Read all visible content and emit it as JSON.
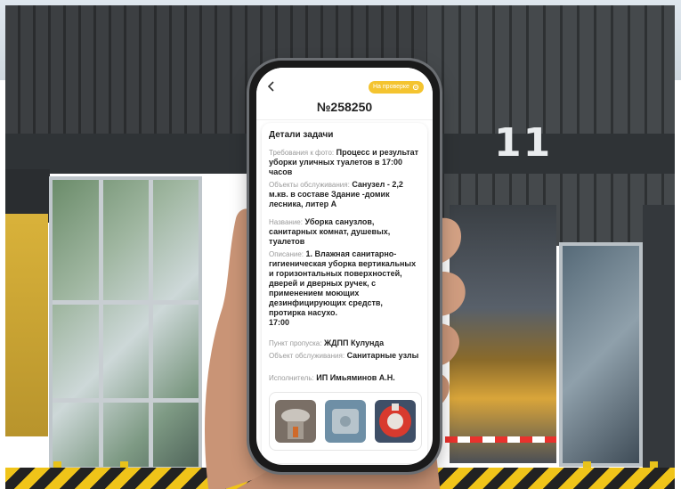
{
  "building": {
    "unit_number": "11"
  },
  "header": {
    "back_icon": "chevron-left-icon",
    "status_label": "На проверке",
    "status_icon": "gear-icon",
    "task_number": "№258250",
    "accent_color": "#f4c430"
  },
  "details": {
    "title": "Детали задачи",
    "photo_requirements": {
      "label": "Требования к фото:",
      "value": "Процесс и результат уборки уличных туалетов  в 17:00 часов"
    },
    "service_objects": {
      "label": "Объекты обслуживания:",
      "value": "Санузел - 2,2 м.кв. в составе Здание -домик лесника, литер А"
    },
    "name": {
      "label": "Название:",
      "value": "Уборка санузлов, санитарных комнат, душевых, туалетов"
    },
    "description": {
      "label": "Описание:",
      "value": "1. Влажная санитарно-гигиеническая уборка вертикальных и горизонтальных поверхностей, дверей и дверных ручек,  с применением моющих дезинфицирующих средств, протирка насухо.",
      "time": "17:00"
    },
    "checkpoint": {
      "label": "Пункт пропуска:",
      "value": "ЖДПП Кулунда"
    },
    "service_object": {
      "label": "Объект обслуживания:",
      "value": "Санитарные узлы"
    },
    "executor": {
      "label": "Исполнитель:",
      "value": "ИП Имьяминов А.Н."
    }
  },
  "photos": [
    {
      "icon": "photo-sink-icon"
    },
    {
      "icon": "photo-fixture-icon"
    },
    {
      "icon": "photo-dispenser-icon"
    }
  ]
}
